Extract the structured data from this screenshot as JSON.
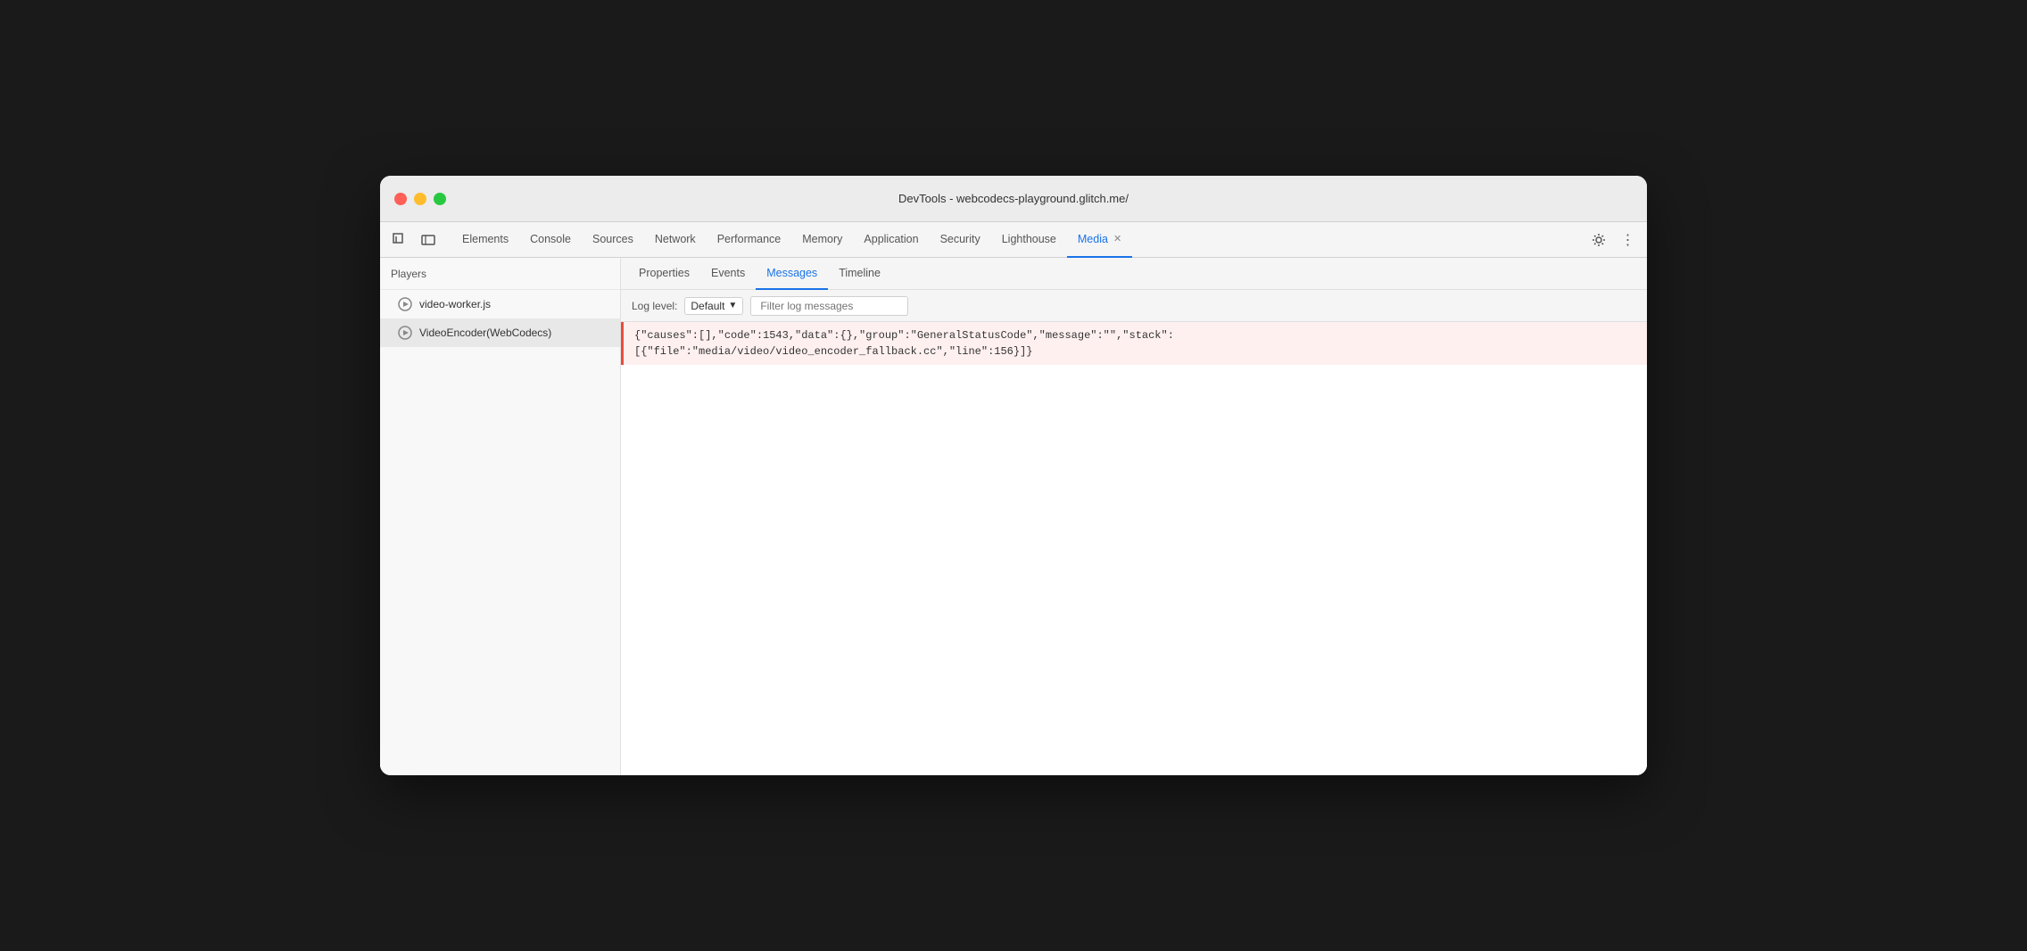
{
  "window": {
    "title": "DevTools - webcodecs-playground.glitch.me/"
  },
  "traffic_lights": {
    "close_label": "close",
    "minimize_label": "minimize",
    "maximize_label": "maximize"
  },
  "toolbar": {
    "inspect_icon": "⬚",
    "device_icon": "▭",
    "tabs": [
      {
        "id": "elements",
        "label": "Elements",
        "active": false
      },
      {
        "id": "console",
        "label": "Console",
        "active": false
      },
      {
        "id": "sources",
        "label": "Sources",
        "active": false
      },
      {
        "id": "network",
        "label": "Network",
        "active": false
      },
      {
        "id": "performance",
        "label": "Performance",
        "active": false
      },
      {
        "id": "memory",
        "label": "Memory",
        "active": false
      },
      {
        "id": "application",
        "label": "Application",
        "active": false
      },
      {
        "id": "security",
        "label": "Security",
        "active": false
      },
      {
        "id": "lighthouse",
        "label": "Lighthouse",
        "active": false
      },
      {
        "id": "media",
        "label": "Media",
        "active": true,
        "closeable": true
      }
    ],
    "settings_icon": "⚙",
    "more_icon": "⋮"
  },
  "sidebar": {
    "header_label": "Players",
    "items": [
      {
        "id": "video-worker",
        "label": "video-worker.js",
        "selected": false
      },
      {
        "id": "video-encoder",
        "label": "VideoEncoder(WebCodecs)",
        "selected": true
      }
    ]
  },
  "sub_tabs": [
    {
      "id": "properties",
      "label": "Properties",
      "active": false
    },
    {
      "id": "events",
      "label": "Events",
      "active": false
    },
    {
      "id": "messages",
      "label": "Messages",
      "active": true
    },
    {
      "id": "timeline",
      "label": "Timeline",
      "active": false
    }
  ],
  "log_controls": {
    "log_level_label": "Log level:",
    "log_level_value": "Default",
    "dropdown_icon": "▼",
    "filter_placeholder": "Filter log messages"
  },
  "log_entries": [
    {
      "type": "error",
      "text": "{\"causes\":[],\"code\":1543,\"data\":{},\"group\":\"GeneralStatusCode\",\"message\":\"\",\"stack\":\n[{\"file\":\"media/video/video_encoder_fallback.cc\",\"line\":156}]}"
    }
  ]
}
